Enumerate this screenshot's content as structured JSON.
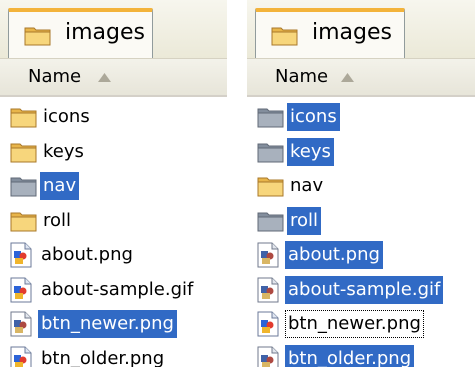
{
  "left_panel": {
    "tab_label": "images",
    "column_header": "Name",
    "rows": [
      {
        "name": "icons",
        "type": "folder",
        "selected": false
      },
      {
        "name": "keys",
        "type": "folder",
        "selected": false
      },
      {
        "name": "nav",
        "type": "folder",
        "selected": true
      },
      {
        "name": "roll",
        "type": "folder",
        "selected": false
      },
      {
        "name": "about.png",
        "type": "file",
        "selected": false
      },
      {
        "name": "about-sample.gif",
        "type": "file",
        "selected": false
      },
      {
        "name": "btn_newer.png",
        "type": "file",
        "selected": true
      },
      {
        "name": "btn_older.png",
        "type": "file",
        "selected": false
      }
    ]
  },
  "right_panel": {
    "tab_label": "images",
    "column_header": "Name",
    "rows": [
      {
        "name": "icons",
        "type": "folder",
        "selected": true
      },
      {
        "name": "keys",
        "type": "folder",
        "selected": true
      },
      {
        "name": "nav",
        "type": "folder",
        "selected": false
      },
      {
        "name": "roll",
        "type": "folder",
        "selected": true
      },
      {
        "name": "about.png",
        "type": "file",
        "selected": true
      },
      {
        "name": "about-sample.gif",
        "type": "file",
        "selected": true
      },
      {
        "name": "btn_newer.png",
        "type": "file",
        "selected": false,
        "focused": true
      },
      {
        "name": "btn_older.png",
        "type": "file",
        "selected": true
      }
    ]
  },
  "colors": {
    "selection": "#316ac5",
    "folder": "#f3c45c",
    "tab_accent": "#f3b33a"
  },
  "icons": {
    "folder": "folder-icon",
    "file": "image-file-icon",
    "sort": "sort-ascending-icon"
  }
}
